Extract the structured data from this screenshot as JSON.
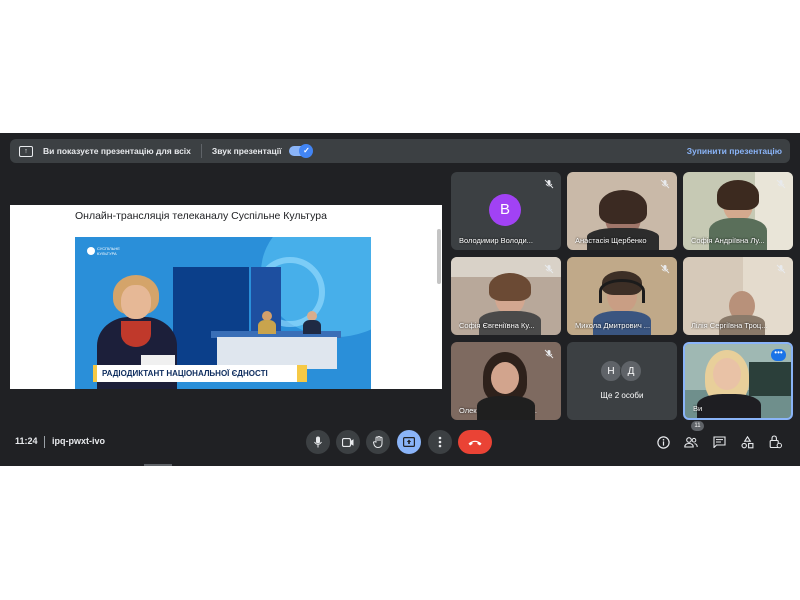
{
  "banner": {
    "message": "Ви показуєте презентацію для всіх",
    "audio_label": "Звук презентації",
    "stop_label": "Зупинити презентацію",
    "present_icon": "present-to-all-icon"
  },
  "presentation": {
    "slide_title": "Онлайн-трансляція телеканалу Суспільне Культура",
    "video_logo_line1": "СУСПІЛЬНЕ",
    "video_logo_line2": "КУЛЬТУРА",
    "lower_third": "РАДІОДИКТАНТ НАЦІОНАЛЬНОЇ ЄДНОСТІ"
  },
  "participants": [
    {
      "name": "Володимир Володи...",
      "avatar_letter": "В",
      "avatar_color": "#a142f4",
      "muted": true
    },
    {
      "name": "Анастасія Щербенко",
      "muted": true
    },
    {
      "name": "Софія Андріївна Лу...",
      "muted": true
    },
    {
      "name": "Софія Євгеніївна Ку...",
      "muted": true
    },
    {
      "name": "Микола Дмитрович ...",
      "muted": true
    },
    {
      "name": "Лілія Сергіївна Троц...",
      "muted": true
    },
    {
      "name": "Олександра Василів...",
      "muted": true
    }
  ],
  "more_tile": {
    "label": "Ще 2 особи",
    "avatars": [
      {
        "letter": "Н",
        "color": "#5f6368"
      },
      {
        "letter": "Д",
        "color": "#5f6368"
      }
    ]
  },
  "self_tile": {
    "name": "Ви",
    "more_icon": "more-horizontal-icon"
  },
  "bottom": {
    "time": "11:24",
    "meeting_code": "ipq-pwxt-ivo",
    "people_count": "11"
  },
  "colors": {
    "background": "#202124",
    "surface": "#3c4043",
    "accent_blue": "#8ab4f8",
    "end_call_red": "#ea4335"
  }
}
